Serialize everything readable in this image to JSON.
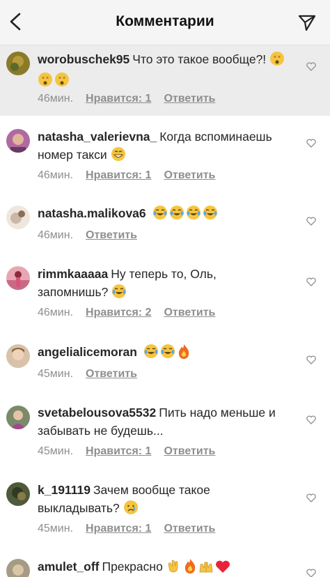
{
  "header": {
    "title": "Комментарии"
  },
  "comments": [
    {
      "user": "worobuschek95",
      "text": "Что это такое вообще?!",
      "emoji": [
        "dizzy",
        "dizzy",
        "dizzy"
      ],
      "time": "46мин.",
      "likes": "Нравится: 1",
      "reply": "Ответить",
      "avatar_color": "#8a7a2a"
    },
    {
      "user": "natasha_valerievna_",
      "text": "Когда вспоминаешь номер такси",
      "emoji": [
        "grin"
      ],
      "time": "46мин.",
      "likes": "Нравится: 1",
      "reply": "Ответить",
      "avatar_color": "#b06aa0"
    },
    {
      "user": "natasha.malikova6",
      "text": "",
      "emoji": [
        "laugh",
        "laugh",
        "laugh",
        "laugh"
      ],
      "time": "46мин.",
      "likes": "",
      "reply": "Ответить",
      "avatar_color": "#c9b8a8"
    },
    {
      "user": "rimmkaaaaa",
      "text": "Ну теперь то, Оль, запомнишь?",
      "emoji": [
        "laugh"
      ],
      "time": "46мин.",
      "likes": "Нравится: 2",
      "reply": "Ответить",
      "avatar_color": "#d6557a"
    },
    {
      "user": "angelialicemoran",
      "text": "",
      "emoji": [
        "laugh",
        "laugh",
        "fire"
      ],
      "time": "45мин.",
      "likes": "",
      "reply": "Ответить",
      "avatar_color": "#d8c2aa"
    },
    {
      "user": "svetabelousova5532",
      "text": "Пить надо меньше и забывать не будешь...",
      "emoji": [],
      "time": "45мин.",
      "likes": "Нравится: 1",
      "reply": "Ответить",
      "avatar_color": "#7a8a6a"
    },
    {
      "user": "k_191119",
      "text": "Зачем вообще такое выкладывать?",
      "emoji": [
        "cry"
      ],
      "time": "45мин.",
      "likes": "Нравится: 1",
      "reply": "Ответить",
      "avatar_color": "#4f5a3a"
    },
    {
      "user": "amulet_off",
      "text": "Прекрасно",
      "emoji": [
        "clap",
        "fire",
        "raise",
        "heart"
      ],
      "time": "",
      "likes": "",
      "reply": "",
      "avatar_color": "#a59c86"
    }
  ]
}
